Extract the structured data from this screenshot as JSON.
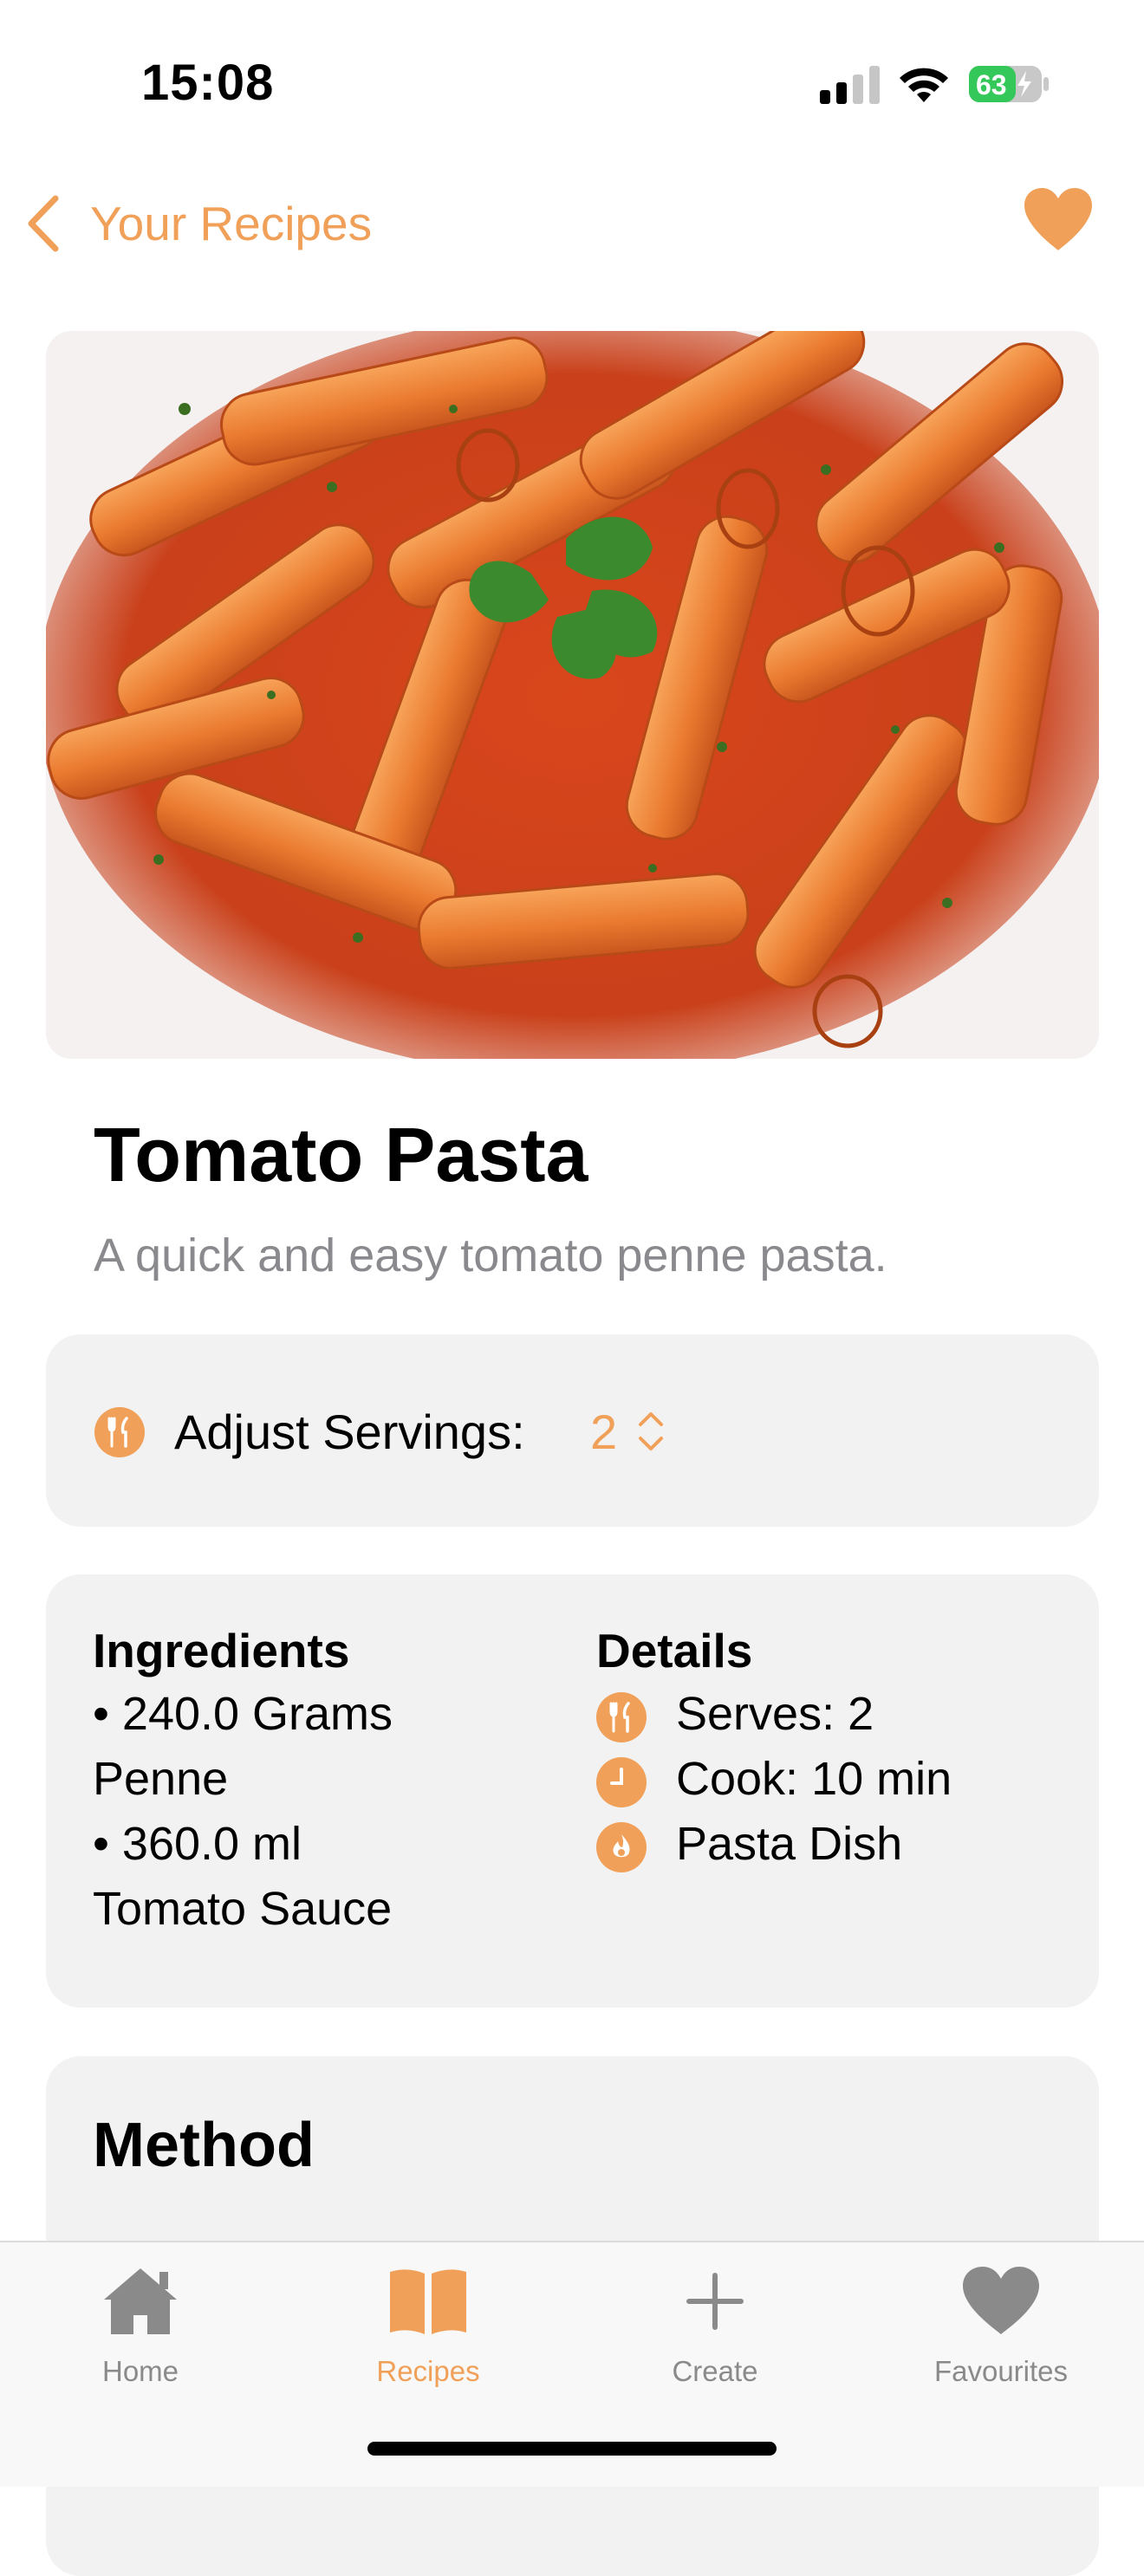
{
  "status": {
    "time": "15:08",
    "battery": "63"
  },
  "nav": {
    "back_label": "Your Recipes"
  },
  "recipe": {
    "title": "Tomato Pasta",
    "description": "A quick and easy tomato penne pasta."
  },
  "servings": {
    "label": "Adjust Servings:",
    "value": "2"
  },
  "ingredients": {
    "heading": "Ingredients",
    "lines": [
      "• 240.0 Grams",
      "Penne",
      "• 360.0 ml",
      "Tomato Sauce"
    ]
  },
  "details": {
    "heading": "Details",
    "items": [
      {
        "text": "Serves: 2",
        "icon": "fork-knife-icon"
      },
      {
        "text": "Cook: 10 min",
        "icon": "clock-icon"
      },
      {
        "text": "Pasta Dish",
        "icon": "flame-icon"
      }
    ]
  },
  "method": {
    "heading": "Method"
  },
  "tabs": [
    {
      "label": "Home",
      "icon": "house-icon"
    },
    {
      "label": "Recipes",
      "icon": "book-icon",
      "active": true
    },
    {
      "label": "Create",
      "icon": "plus-icon"
    },
    {
      "label": "Favourites",
      "icon": "heart-icon"
    }
  ],
  "colors": {
    "accent": "#f0a058",
    "inactive": "#8a8a8a",
    "card": "#f2f2f2",
    "subtitle": "#8a8a8e"
  }
}
